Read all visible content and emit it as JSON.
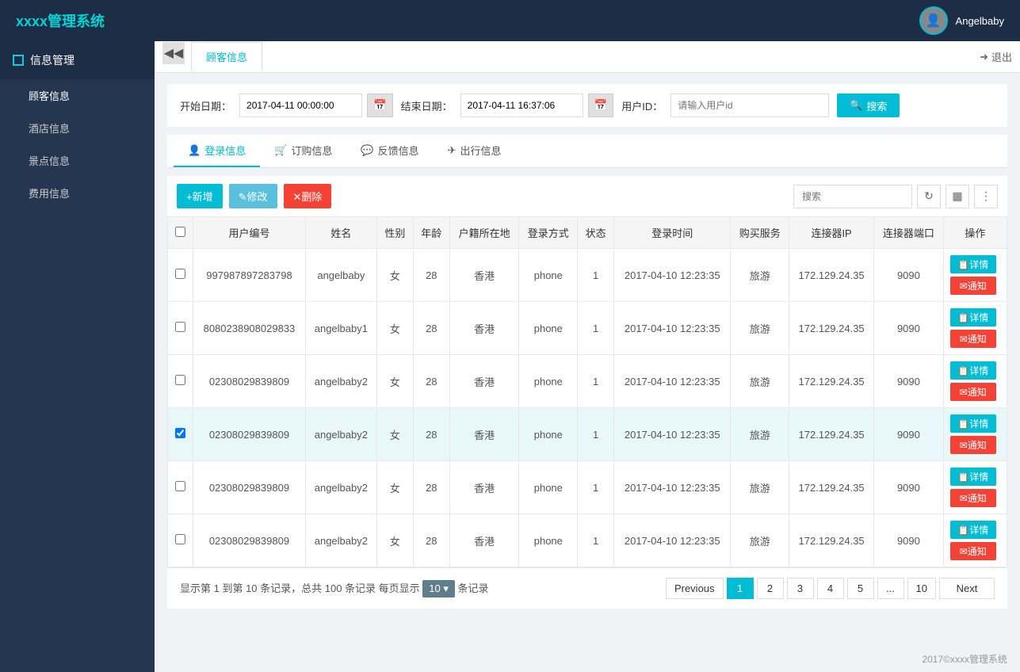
{
  "header": {
    "logo": "xxxx管理系统",
    "username": "Angelbaby",
    "logout_label": "退出"
  },
  "sidebar": {
    "section_title": "信息管理",
    "items": [
      {
        "label": "顾客信息",
        "active": true
      },
      {
        "label": "酒店信息",
        "active": false
      },
      {
        "label": "景点信息",
        "active": false
      },
      {
        "label": "费用信息",
        "active": false
      }
    ]
  },
  "tab_bar": {
    "tabs": [
      {
        "label": "顾客信息",
        "active": true
      }
    ],
    "logout_label": "退出"
  },
  "filter": {
    "start_date_label": "开始日期：",
    "start_date_value": "2017-04-11 00:00:00",
    "end_date_label": "结束日期：",
    "end_date_value": "2017-04-11 16:37:06",
    "userid_label": "用户ID：",
    "userid_placeholder": "请输入用户id",
    "search_btn_label": "搜索"
  },
  "sub_tabs": [
    {
      "label": "登录信息",
      "icon": "person",
      "active": true
    },
    {
      "label": "订购信息",
      "icon": "cart",
      "active": false
    },
    {
      "label": "反馈信息",
      "icon": "chat",
      "active": false
    },
    {
      "label": "出行信息",
      "icon": "plane",
      "active": false
    }
  ],
  "toolbar": {
    "add_label": "+新增",
    "edit_label": "✎修改",
    "delete_label": "✕删除",
    "search_placeholder": "搜索"
  },
  "table": {
    "columns": [
      "",
      "用户编号",
      "姓名",
      "性别",
      "年龄",
      "户籍所在地",
      "登录方式",
      "状态",
      "登录时间",
      "购买服务",
      "连接器IP",
      "连接器端口",
      "操作"
    ],
    "rows": [
      {
        "checked": false,
        "id": "997987897283798",
        "name": "angelbaby",
        "gender": "女",
        "age": "28",
        "location": "香港",
        "login_method": "phone",
        "status": "1",
        "login_time": "2017-04-10 12:23:35",
        "service": "旅游",
        "ip": "172.129.24.35",
        "port": "9090",
        "selected": false
      },
      {
        "checked": false,
        "id": "8080238908029833",
        "name": "angelbaby1",
        "gender": "女",
        "age": "28",
        "location": "香港",
        "login_method": "phone",
        "status": "1",
        "login_time": "2017-04-10 12:23:35",
        "service": "旅游",
        "ip": "172.129.24.35",
        "port": "9090",
        "selected": false
      },
      {
        "checked": false,
        "id": "02308029839809",
        "name": "angelbaby2",
        "gender": "女",
        "age": "28",
        "location": "香港",
        "login_method": "phone",
        "status": "1",
        "login_time": "2017-04-10 12:23:35",
        "service": "旅游",
        "ip": "172.129.24.35",
        "port": "9090",
        "selected": false
      },
      {
        "checked": true,
        "id": "02308029839809",
        "name": "angelbaby2",
        "gender": "女",
        "age": "28",
        "location": "香港",
        "login_method": "phone",
        "status": "1",
        "login_time": "2017-04-10 12:23:35",
        "service": "旅游",
        "ip": "172.129.24.35",
        "port": "9090",
        "selected": true
      },
      {
        "checked": false,
        "id": "02308029839809",
        "name": "angelbaby2",
        "gender": "女",
        "age": "28",
        "location": "香港",
        "login_method": "phone",
        "status": "1",
        "login_time": "2017-04-10 12:23:35",
        "service": "旅游",
        "ip": "172.129.24.35",
        "port": "9090",
        "selected": false
      },
      {
        "checked": false,
        "id": "02308029839809",
        "name": "angelbaby2",
        "gender": "女",
        "age": "28",
        "location": "香港",
        "login_method": "phone",
        "status": "1",
        "login_time": "2017-04-10 12:23:35",
        "service": "旅游",
        "ip": "172.129.24.35",
        "port": "9090",
        "selected": false
      }
    ],
    "action_detail": "详情",
    "action_notify": "通知"
  },
  "pagination": {
    "info": "显示第 1 到第 10 条记录，总共 100 条记录 每页显示",
    "page_size": "10",
    "records_suffix": "条记录",
    "prev_label": "Previous",
    "next_label": "Next",
    "pages": [
      "1",
      "2",
      "3",
      "4",
      "5",
      "...",
      "10"
    ],
    "active_page": "1"
  },
  "footer": {
    "copyright": "2017©xxxx管理系统"
  }
}
